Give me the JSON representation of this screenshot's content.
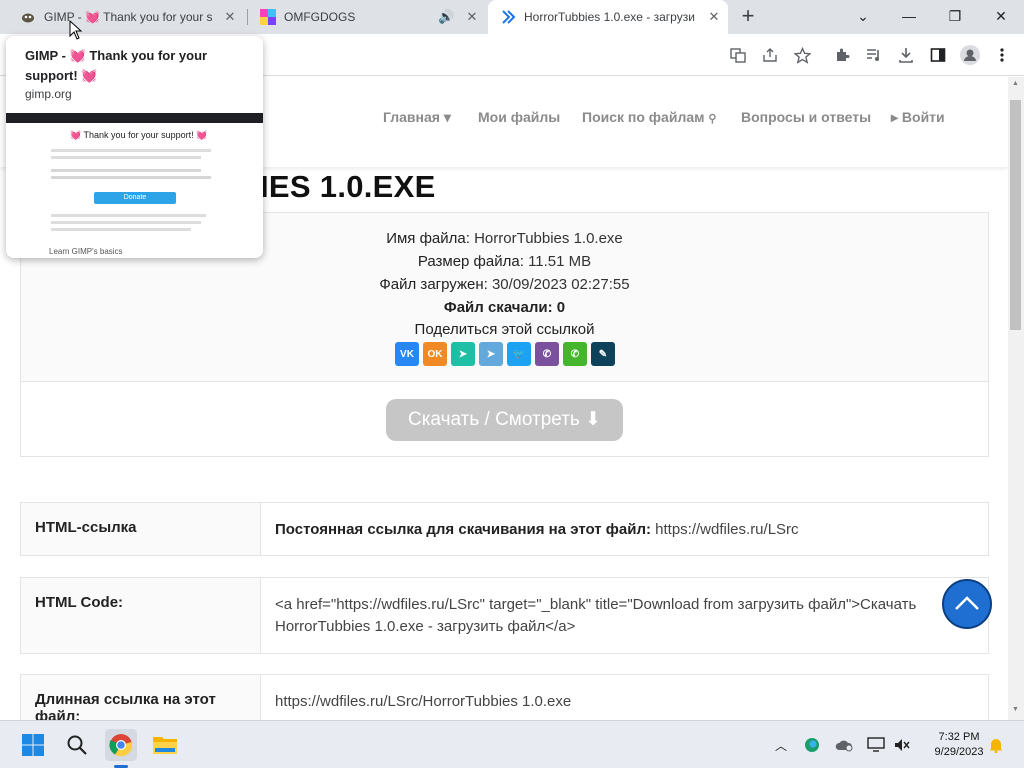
{
  "tabs": [
    {
      "title": "GIMP - 💓 Thank you for your s",
      "active": false
    },
    {
      "title": "OMFGDOGS",
      "active": false
    },
    {
      "title": "HorrorTubbies 1.0.exe - загрузи",
      "active": true
    }
  ],
  "hover_card": {
    "title": "GIMP - 💓 Thank you for your support! 💓",
    "domain": "gimp.org",
    "preview_heading": "💓 Thank you for your support! 💓",
    "preview_button": "Donate",
    "preview_footer": "Learn GIMP's basics"
  },
  "nav": {
    "home": "Главная ▾",
    "my_files": "Мои файлы",
    "search": "Поиск по файлам",
    "faq": "Вопросы и ответы",
    "login": "▸ Войти"
  },
  "heading": "IES 1.0.EXE",
  "file_info": {
    "name_label": "Имя файла:",
    "name_value": "HorrorTubbies 1.0.exe",
    "size_label": "Размер файла:",
    "size_value": "11.51 MB",
    "uploaded_label": "Файл загружен:",
    "uploaded_value": "30/09/2023 02:27:55",
    "downloads": "Файл скачали: 0",
    "share_label": "Поделиться этой ссылкой"
  },
  "share_icons": [
    {
      "name": "vk-share-icon",
      "glyph": "VK",
      "color": "#2787f5"
    },
    {
      "name": "ok-share-icon",
      "glyph": "OK",
      "color": "#f18a25"
    },
    {
      "name": "mailru-share-icon",
      "glyph": "➤",
      "color": "#1fbfa5"
    },
    {
      "name": "telegram-share-icon",
      "glyph": "➤",
      "color": "#64a9dc"
    },
    {
      "name": "twitter-share-icon",
      "glyph": "🐦",
      "color": "#1da1f2"
    },
    {
      "name": "viber-share-icon",
      "glyph": "✆",
      "color": "#7b519d"
    },
    {
      "name": "whatsapp-share-icon",
      "glyph": "✆",
      "color": "#44b52d"
    },
    {
      "name": "livejournal-share-icon",
      "glyph": "✎",
      "color": "#0d425a"
    }
  ],
  "download_button": "Скачать / Смотреть ⬇",
  "rows": [
    {
      "label": "HTML-ссылка",
      "value_bold": "Постоянная ссылка для скачивания на этот файл:",
      "value": " https://wdfiles.ru/LSrc"
    },
    {
      "label": "HTML Code:",
      "value_bold": "",
      "value": "<a href=\"https://wdfiles.ru/LSrc\" target=\"_blank\" title=\"Download from загрузить файл\">Скачать HorrorTubbies 1.0.exe - загрузить файл</a>"
    },
    {
      "label": "Длинная ссылка на этот файл:",
      "value_bold": "",
      "value": "https://wdfiles.ru/LSrc/HorrorTubbies 1.0.exe"
    }
  ],
  "clock": {
    "time": "7:32 PM",
    "date": "9/29/2023"
  },
  "colors": {
    "accent": "#1e6fd1",
    "download_disabled": "#c6c6c6"
  }
}
